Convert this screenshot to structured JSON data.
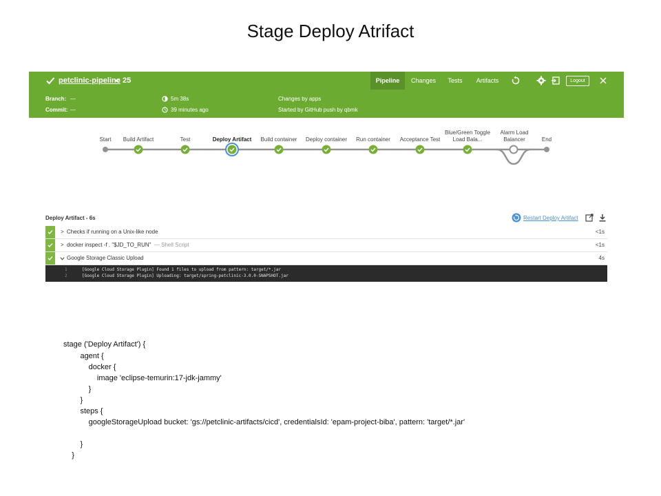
{
  "slide": {
    "title": "Stage Deploy Atrifact"
  },
  "header": {
    "pipeline_name": "petclinic-pipeline",
    "run_separator": "<",
    "run_number": "25",
    "tabs": [
      {
        "label": "Pipeline",
        "active": true
      },
      {
        "label": "Changes",
        "active": false
      },
      {
        "label": "Tests",
        "active": false
      },
      {
        "label": "Artifacts",
        "active": false
      }
    ],
    "logout_label": "Logout",
    "branch_label": "Branch:",
    "branch_value": "—",
    "commit_label": "Commit:",
    "commit_value": "—",
    "duration": "5m 38s",
    "started_ago": "39 minutes ago",
    "changes": "Changes by apps",
    "started_by": "Started by GitHub push by qbmk",
    "color": "#6cab32",
    "active_tab_color": "#5a9128"
  },
  "stages": [
    {
      "label": "Start",
      "status": "start"
    },
    {
      "label": "Build Artifact",
      "status": "success"
    },
    {
      "label": "Test",
      "status": "success"
    },
    {
      "label": "Deploy Artifact",
      "status": "selected"
    },
    {
      "label": "Build container",
      "status": "success"
    },
    {
      "label": "Deploy container",
      "status": "success"
    },
    {
      "label": "Run container",
      "status": "success"
    },
    {
      "label": "Acceptance Test",
      "status": "success"
    },
    {
      "label": "Blue/Green Toggle Load Bala...",
      "status": "success"
    },
    {
      "label": "Alarm Load Balancer",
      "status": "not-built"
    },
    {
      "label": "End",
      "status": "end"
    }
  ],
  "panel": {
    "title": "Deploy Artifact - 6s",
    "restart_label": "Restart Deploy Artifact",
    "steps": [
      {
        "text": "Checks if running on a Unix-like node",
        "subtext": "",
        "time": "<1s",
        "expanded": false
      },
      {
        "text": "docker inspect -f . \"$JD_TO_RUN\"",
        "subtext": "— Shell Script",
        "time": "<1s",
        "expanded": false
      },
      {
        "text": "Google Storage Classic Upload",
        "subtext": "",
        "time": "4s",
        "expanded": true
      }
    ],
    "log": [
      {
        "num": "1",
        "text": "[Google Cloud Storage Plugin] Found 1 files to upload from pattern: target/*.jar"
      },
      {
        "num": "2",
        "text": "[Google Cloud Storage Plugin] Uploading: target/spring-petclinic-3.0.0-SNAPSHOT.jar"
      }
    ]
  },
  "code": [
    "stage ('Deploy Artifact') {",
    "        agent {",
    "            docker {",
    "                image 'eclipse-temurin:17-jdk-jammy'",
    "            }",
    "        }",
    "        steps {",
    "            googleStorageUpload bucket: 'gs://petclinic-artifacts/cicd', credentialsId: 'epam-project-biba', pattern: 'target/*.jar'",
    "",
    "        }",
    "    }"
  ]
}
